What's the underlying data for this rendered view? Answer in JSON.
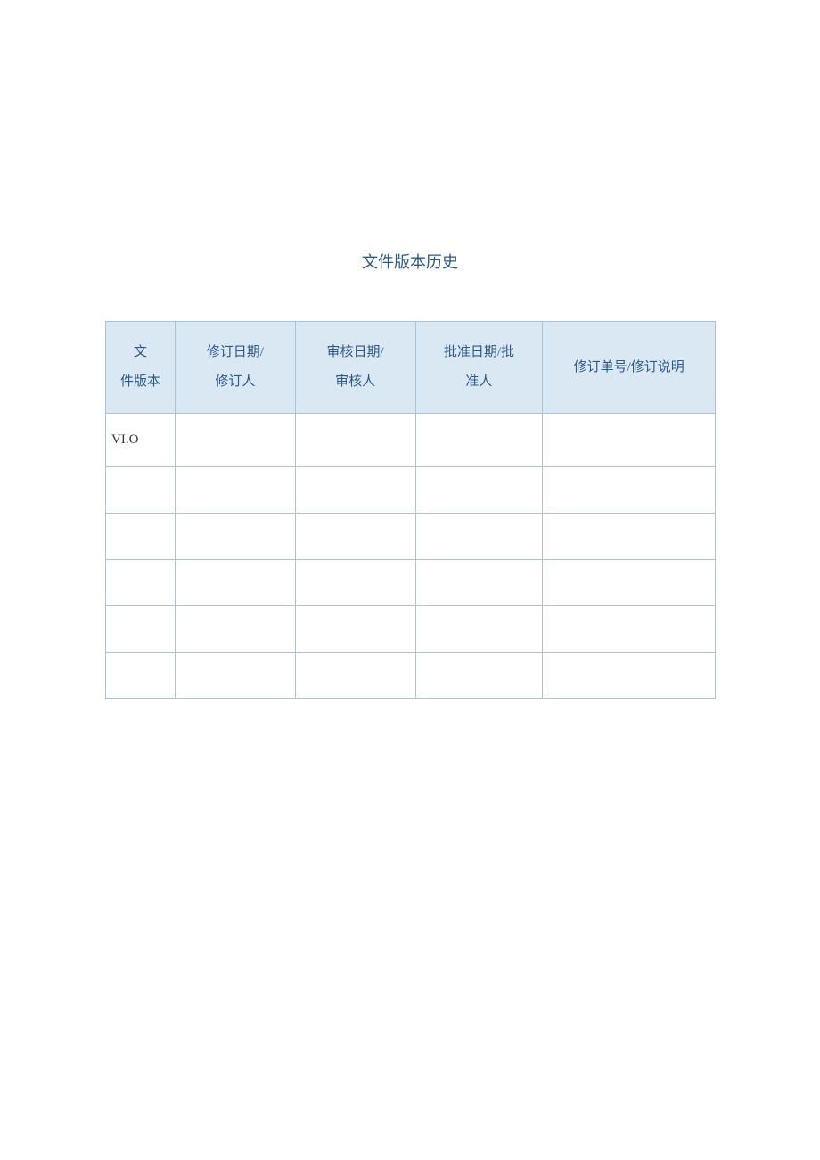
{
  "title": "文件版本历史",
  "table": {
    "headers": {
      "version": "文\n件版本",
      "revise": "修订日期/\n修订人",
      "review": "审核日期/\n审核人",
      "approve": "批准日期/批\n准人",
      "description": "修订单号/修订说明"
    },
    "rows": [
      {
        "version": "VI.O",
        "revise": "",
        "review": "",
        "approve": "",
        "description": ""
      },
      {
        "version": "",
        "revise": "",
        "review": "",
        "approve": "",
        "description": ""
      },
      {
        "version": "",
        "revise": "",
        "review": "",
        "approve": "",
        "description": ""
      },
      {
        "version": "",
        "revise": "",
        "review": "",
        "approve": "",
        "description": ""
      },
      {
        "version": "",
        "revise": "",
        "review": "",
        "approve": "",
        "description": ""
      },
      {
        "version": "",
        "revise": "",
        "review": "",
        "approve": "",
        "description": ""
      }
    ]
  }
}
